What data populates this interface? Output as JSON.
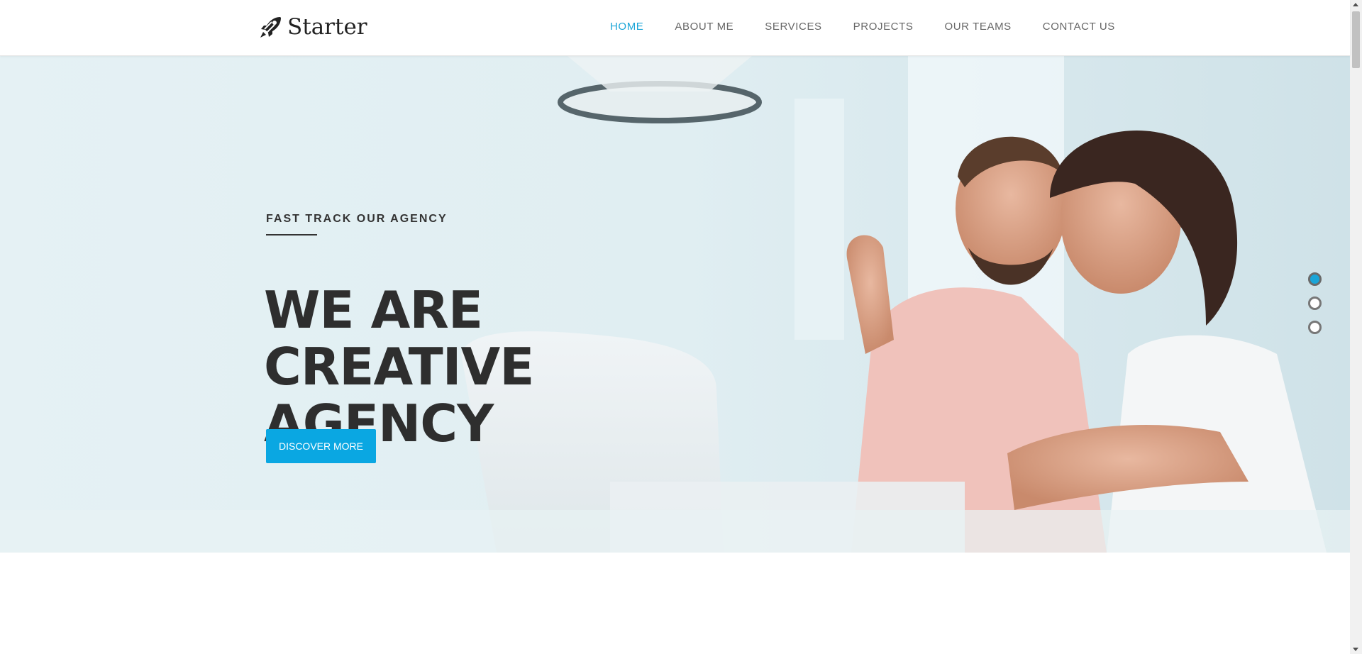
{
  "brand": {
    "name": "Starter",
    "icon": "rocket-icon"
  },
  "nav": {
    "items": [
      {
        "label": "HOME",
        "active": true
      },
      {
        "label": "ABOUT ME",
        "active": false
      },
      {
        "label": "SERVICES",
        "active": false
      },
      {
        "label": "PROJECTS",
        "active": false
      },
      {
        "label": "OUR TEAMS",
        "active": false
      },
      {
        "label": "CONTACT US",
        "active": false
      }
    ]
  },
  "hero": {
    "eyebrow": "FAST TRACK OUR AGENCY",
    "headline_line1": "WE ARE CREATIVE",
    "headline_line2": "AGENCY",
    "cta_label": "DISCOVER MORE",
    "slides": {
      "count": 3,
      "active": 1
    }
  },
  "colors": {
    "accent": "#0aa7e2",
    "nav_active": "#1aa5d8",
    "headline": "#2e2e2e"
  }
}
